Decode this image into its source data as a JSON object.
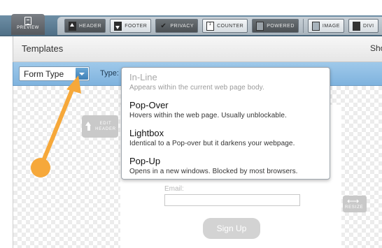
{
  "toolbar": {
    "preview_label": "PREVIEW",
    "buttons": [
      {
        "label": "HEADER",
        "icon": "arrow-up-icon"
      },
      {
        "label": "FOOTER",
        "icon": "arrow-down-icon"
      },
      {
        "label": "PRIVACY",
        "icon": "check-icon"
      },
      {
        "label": "COUNTER",
        "icon": "counter-icon"
      },
      {
        "label": "POWERED",
        "icon": "powered-icon"
      },
      {
        "label": "IMAGE",
        "icon": "image-icon"
      },
      {
        "label": "DIVI",
        "icon": "divider-icon"
      }
    ]
  },
  "templates_bar": {
    "title": "Templates",
    "right_text": "Sho"
  },
  "filter_bar": {
    "form_type_label": "Form Type",
    "type_label": "Type:"
  },
  "menu": {
    "items": [
      {
        "name": "In-Line",
        "desc": "Appears within the current web page body.",
        "enabled": false
      },
      {
        "name": "Pop-Over",
        "desc": "Hovers within the web page. Usually unblockable.",
        "enabled": true
      },
      {
        "name": "Lightbox",
        "desc": "Identical to a Pop-over but it darkens your webpage.",
        "enabled": true
      },
      {
        "name": "Pop-Up",
        "desc": "Opens in a new windows. Blocked by most browsers.",
        "enabled": true
      }
    ]
  },
  "canvas": {
    "edit_header_line1": "EDIT",
    "edit_header_line2": "HEADER",
    "email_label": "Email:",
    "email_value": "",
    "signup_label": "Sign Up",
    "resize_label": "RESIZE"
  },
  "colors": {
    "annotation_arrow": "#f6a83a",
    "filter_bar": "#8ebfe5",
    "toolbar_band": "#5f7f95"
  }
}
